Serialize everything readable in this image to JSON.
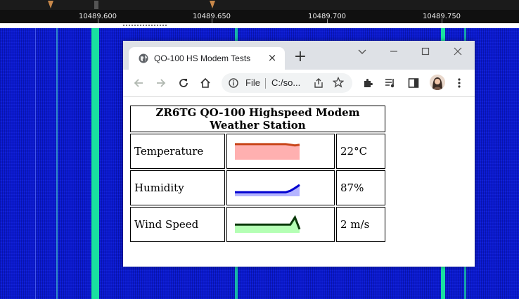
{
  "sdr": {
    "frequency_labels": [
      "10489.600",
      "10489.650",
      "10489.700",
      "10489.750"
    ],
    "colors": {
      "waterfall": "#0b1ad0",
      "signal": "#19e0a0"
    }
  },
  "browser": {
    "tab_title": "QO-100 HS Modem Tests",
    "url_scheme_label": "File",
    "url": "C:/so...",
    "controls": {
      "new_tab": "+",
      "tab_close": "×"
    }
  },
  "page": {
    "heading": "ZR6TG QO-100 Highspeed Modem Weather Station",
    "rows": [
      {
        "label": "Temperature",
        "value": "22°C",
        "line_color": "#c84418",
        "fill_color": "#ffb0b0",
        "series": [
          0.85,
          0.85,
          0.85,
          0.85,
          0.85,
          0.85,
          0.85,
          0.85,
          0.85,
          0.85,
          0.85,
          0.85,
          0.82,
          0.78,
          0.82
        ]
      },
      {
        "label": "Humidity",
        "value": "87%",
        "line_color": "#0000d0",
        "fill_color": "#b4b4ff",
        "series": [
          0.22,
          0.22,
          0.22,
          0.22,
          0.22,
          0.22,
          0.22,
          0.22,
          0.22,
          0.22,
          0.22,
          0.22,
          0.3,
          0.45,
          0.62
        ]
      },
      {
        "label": "Wind Speed",
        "value": "2 m/s",
        "line_color": "#0a3a0a",
        "fill_color": "#b4ffb4",
        "series": [
          0.45,
          0.45,
          0.45,
          0.45,
          0.45,
          0.45,
          0.45,
          0.45,
          0.45,
          0.45,
          0.45,
          0.45,
          0.45,
          0.85,
          0.2
        ]
      }
    ]
  }
}
